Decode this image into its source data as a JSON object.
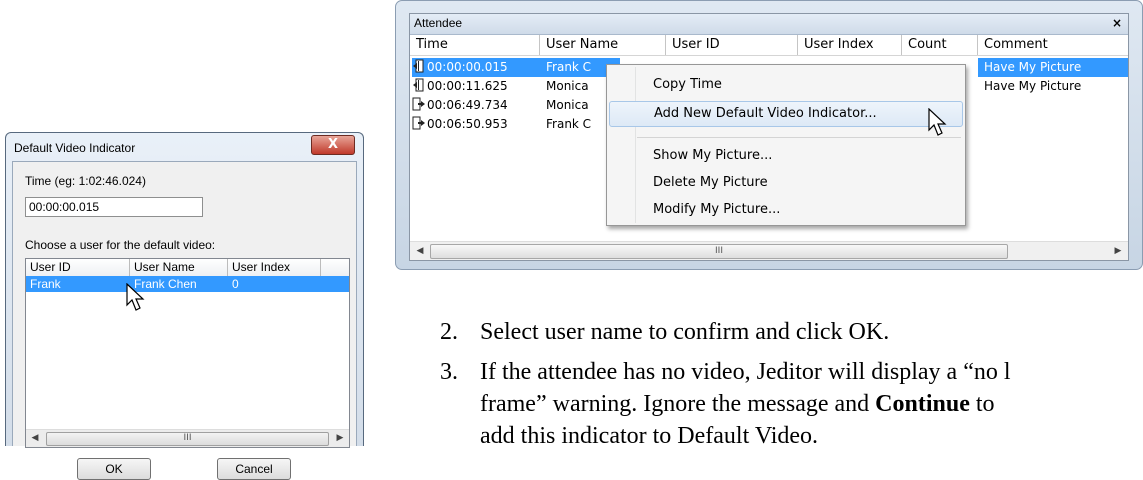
{
  "dialog": {
    "title": "Default Video Indicator",
    "close_glyph": "X",
    "time_label": "Time (eg: 1:02:46.024)",
    "time_value": "00:00:00.015",
    "user_label": "Choose a user for the default video:",
    "columns": [
      "User ID",
      "User Name",
      "User Index"
    ],
    "rows": [
      {
        "user_id": "Frank",
        "user_name": "Frank Chen",
        "user_index": "0"
      }
    ],
    "scroll_grip": "III",
    "ok_label": "OK",
    "cancel_label": "Cancel"
  },
  "attendee": {
    "title": "Attendee",
    "close_glyph": "×",
    "columns": [
      "Time",
      "User Name",
      "User ID",
      "User Index",
      "Count",
      "Comment"
    ],
    "rows": [
      {
        "time": "00:00:00.015",
        "user_name": "Frank C",
        "comment": "Have My Picture",
        "icon": "exit-door-icon",
        "selected": true
      },
      {
        "time": "00:00:11.625",
        "user_name": "Monica",
        "comment": "Have My Picture",
        "icon": "exit-door-icon",
        "selected": false
      },
      {
        "time": "00:06:49.734",
        "user_name": "Monica",
        "comment": "",
        "icon": "enter-door-icon",
        "selected": false
      },
      {
        "time": "00:06:50.953",
        "user_name": "Frank C",
        "comment": "",
        "icon": "enter-door-icon",
        "selected": false
      }
    ],
    "scroll_grip": "III"
  },
  "context_menu": {
    "items": [
      "Copy Time",
      "Add New Default Video Indicator...",
      "Show My Picture...",
      "Delete My Picture",
      "Modify My Picture..."
    ],
    "highlighted_item": "Add New Default Video Indicator..."
  },
  "instructions": {
    "step2_num": "2.",
    "step2_text": "Select user name to confirm and click OK.",
    "step3_num": "3.",
    "step3_text_a": "If the attendee has no video, Jeditor will display a “no l",
    "step3_text_b_pre": "frame” warning. Ignore the message and ",
    "step3_text_b_bold": "Continue",
    "step3_text_b_post": " to",
    "step3_text_c": "add this indicator to Default Video."
  },
  "colors": {
    "selection": "#3399ff",
    "menu_highlight": "#dde9f6",
    "close_button": "#c0392b"
  }
}
